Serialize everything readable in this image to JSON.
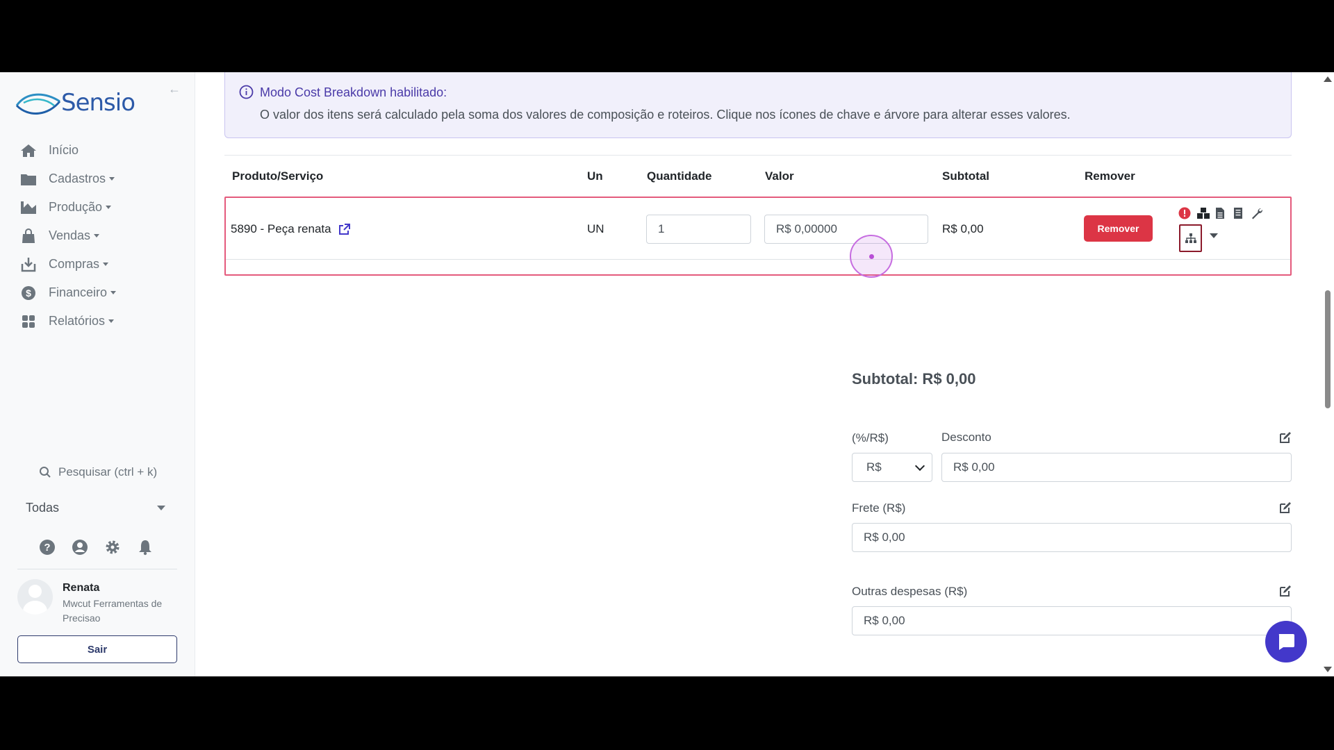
{
  "sidebar": {
    "logo_text": "Sensio",
    "nav": [
      {
        "label": "Início",
        "icon": "home-icon",
        "has_caret": false
      },
      {
        "label": "Cadastros",
        "icon": "folder-icon",
        "has_caret": true
      },
      {
        "label": "Produção",
        "icon": "chart-icon",
        "has_caret": true
      },
      {
        "label": "Vendas",
        "icon": "shopping-bag-icon",
        "has_caret": true
      },
      {
        "label": "Compras",
        "icon": "download-box-icon",
        "has_caret": true
      },
      {
        "label": "Financeiro",
        "icon": "dollar-circle-icon",
        "has_caret": true
      },
      {
        "label": "Relatórios",
        "icon": "grid-icon",
        "has_caret": true
      }
    ],
    "search_placeholder": "Pesquisar (ctrl + k)",
    "company_filter": "Todas",
    "user": {
      "name": "Renata",
      "company": "Mwcut Ferramentas de Precisao"
    },
    "logout_label": "Sair"
  },
  "alert": {
    "title": "Modo Cost Breakdown habilitado:",
    "body": "O valor dos itens será calculado pela soma dos valores de composição e roteiros. Clique nos ícones de chave e árvore para alterar esses valores."
  },
  "table": {
    "headers": {
      "product": "Produto/Serviço",
      "unit": "Un",
      "qty": "Quantidade",
      "value": "Valor",
      "subtotal": "Subtotal",
      "remove": "Remover"
    },
    "row": {
      "product": "5890 - Peça renata",
      "unit": "UN",
      "qty": "1",
      "value": "R$ 0,00000",
      "subtotal": "R$ 0,00",
      "remove_label": "Remover"
    }
  },
  "summary": {
    "subtotal": "Subtotal: R$ 0,00",
    "discount_type_label": "(%/R$)",
    "discount_type_value": "R$",
    "discount_label": "Desconto",
    "discount_value": "R$ 0,00",
    "freight_label": "Frete (R$)",
    "freight_value": "R$ 0,00",
    "other_label": "Outras despesas (R$)",
    "other_value": "R$ 0,00"
  },
  "colors": {
    "accent": "#4338ca",
    "danger": "#dc3545",
    "highlight": "#e45a7c"
  }
}
